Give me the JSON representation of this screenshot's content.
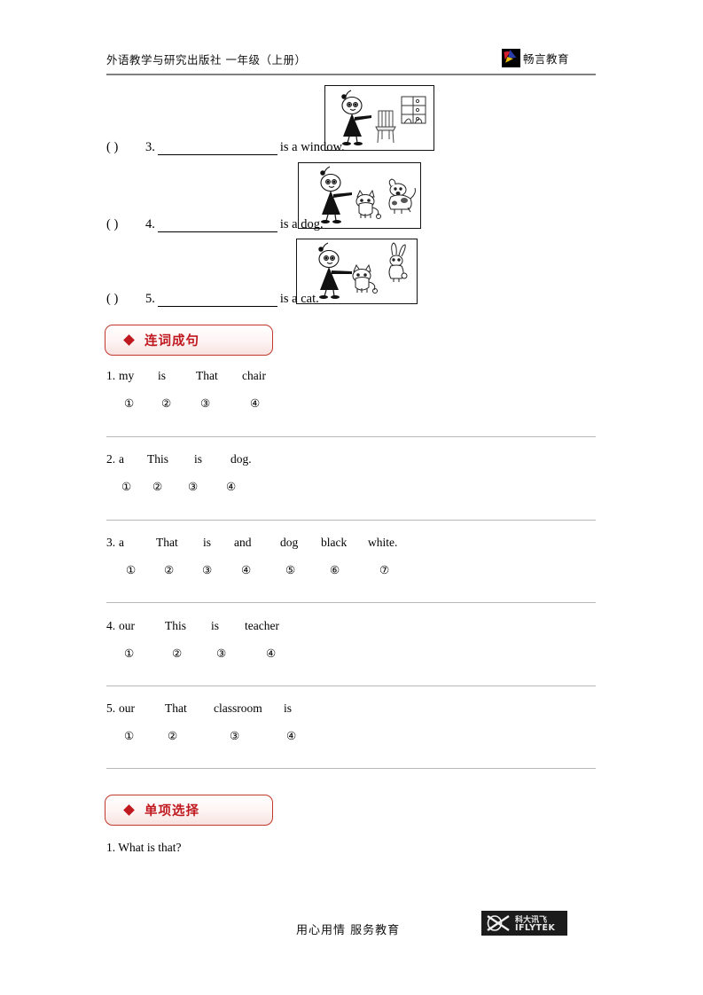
{
  "header": {
    "publisher_line": "外语教学与研究出版社  一年级（上册）",
    "brand_name": "畅言教育",
    "brand_logo_icon": "bird-logo-icon"
  },
  "fill_in_blanks": {
    "items": [
      {
        "paren": "(        )",
        "number": "3.",
        "tail": "is a window.",
        "image_alt": "girl-pointing-at-window-and-chair"
      },
      {
        "paren": "(        )",
        "number": "4.",
        "tail": "is a dog.",
        "image_alt": "girl-pointing-at-dog-and-cat"
      },
      {
        "paren": "(        )",
        "number": "5.",
        "tail": "is a cat.",
        "image_alt": "girl-pointing-at-cat-and-rabbit"
      }
    ]
  },
  "sections": [
    {
      "diamond": "◆",
      "title": "连词成句"
    },
    {
      "diamond": "◆",
      "title": "单项选择"
    }
  ],
  "word_order": {
    "questions": [
      {
        "label": "1.",
        "words": [
          "my",
          "is",
          "That",
          "chair"
        ],
        "marks": [
          "①",
          "②",
          "③",
          "④"
        ]
      },
      {
        "label": "2.",
        "words": [
          "a",
          "This",
          "is",
          "dog."
        ],
        "marks": [
          "①",
          "②",
          "③",
          "④"
        ]
      },
      {
        "label": "3.",
        "words": [
          "a",
          "That",
          "is",
          "and",
          "dog",
          "black",
          "white."
        ],
        "marks": [
          "①",
          "②",
          "③",
          "④",
          "⑤",
          "⑥",
          "⑦"
        ]
      },
      {
        "label": "4.",
        "words": [
          "our",
          "This",
          "is",
          "teacher"
        ],
        "marks": [
          "①",
          "②",
          "③",
          "④"
        ]
      },
      {
        "label": "5.",
        "words": [
          "our",
          "That",
          "classroom",
          "is"
        ],
        "marks": [
          "①",
          "②",
          "③",
          "④"
        ]
      }
    ]
  },
  "multiple_choice": {
    "questions": [
      {
        "text": "1. What is that?"
      }
    ]
  },
  "footer": {
    "slogan": "用心用情   服务教育",
    "logo_cn": "科大讯飞",
    "logo_en": "IFLYTEK",
    "logo_icon": "iflytek-x-mark-icon"
  },
  "colors": {
    "accent_red": "#c0181f",
    "border_red": "#c0392b",
    "rule_gray": "#808080",
    "divider_gray": "#b8b8b8"
  }
}
